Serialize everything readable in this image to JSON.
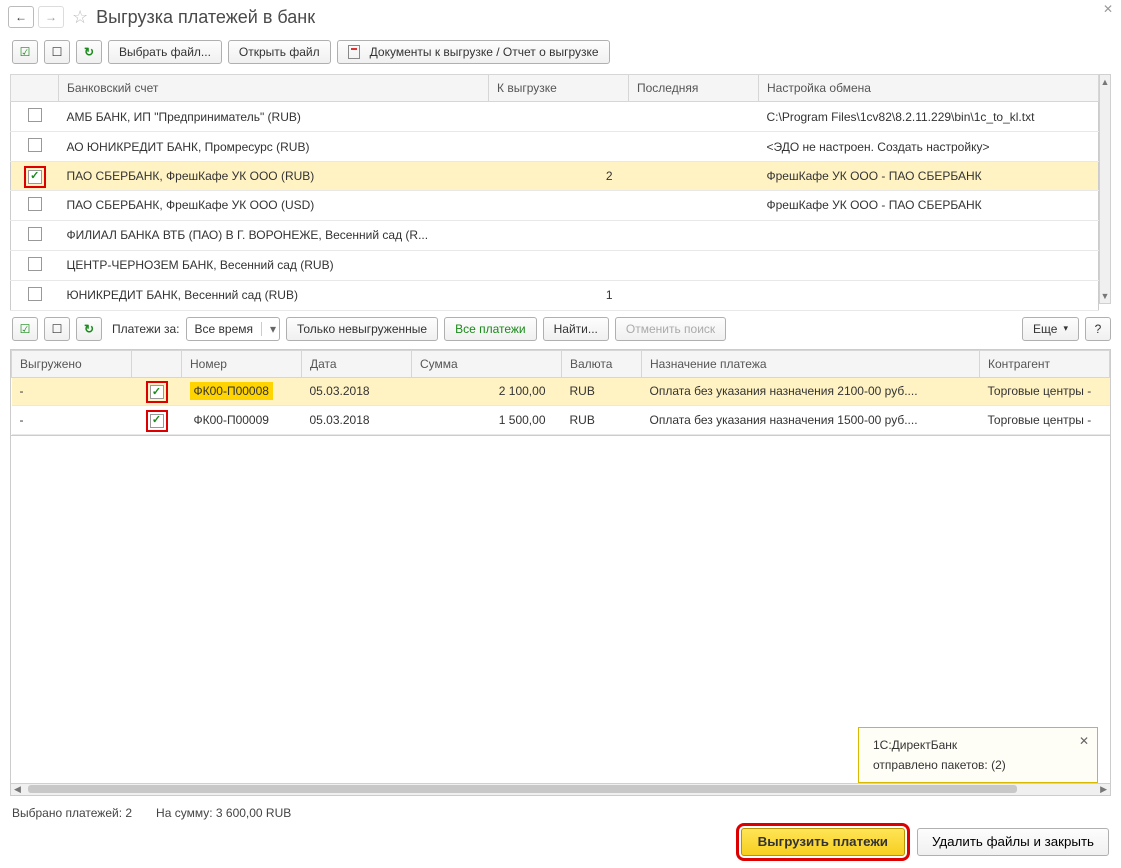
{
  "titlebar": {
    "title": "Выгрузка платежей в банк"
  },
  "toolbar1": {
    "choose_file": "Выбрать файл...",
    "open_file": "Открыть файл",
    "docs_report": "Документы к выгрузке / Отчет о выгрузке"
  },
  "accounts": {
    "headers": {
      "account": "Банковский счет",
      "to_export": "К выгрузке",
      "last": "Последняя",
      "settings": "Настройка обмена"
    },
    "rows": [
      {
        "checked": false,
        "name": "АМБ БАНК, ИП \"Предприниматель\" (RUB)",
        "to_export": "",
        "last": "",
        "settings": "C:\\Program Files\\1cv82\\8.2.11.229\\bin\\1c_to_kl.txt"
      },
      {
        "checked": false,
        "name": "АО ЮНИКРЕДИТ БАНК, Промресурс (RUB)",
        "to_export": "",
        "last": "",
        "settings": "<ЭДО не настроен. Создать настройку>"
      },
      {
        "checked": true,
        "name": "ПАО СБЕРБАНК, ФрешКафе УК ООО (RUB)",
        "to_export": "2",
        "last": "",
        "settings": "ФрешКафе УК ООО - ПАО СБЕРБАНК",
        "selected": true,
        "highlight": true
      },
      {
        "checked": false,
        "name": "ПАО СБЕРБАНК, ФрешКафе УК ООО (USD)",
        "to_export": "",
        "last": "",
        "settings": "ФрешКафе УК ООО - ПАО СБЕРБАНК"
      },
      {
        "checked": false,
        "name": "ФИЛИАЛ БАНКА ВТБ (ПАО) В Г. ВОРОНЕЖЕ, Весенний сад (R...",
        "to_export": "",
        "last": "",
        "settings": ""
      },
      {
        "checked": false,
        "name": "ЦЕНТР-ЧЕРНОЗЕМ БАНК, Весенний сад (RUB)",
        "to_export": "",
        "last": "",
        "settings": ""
      },
      {
        "checked": false,
        "name": "ЮНИКРЕДИТ БАНК, Весенний сад (RUB)",
        "to_export": "1",
        "last": "",
        "settings": ""
      }
    ]
  },
  "toolbar2": {
    "label_payments_for": "Платежи за:",
    "period_value": "Все время",
    "only_unexported": "Только невыгруженные",
    "all_payments": "Все платежи",
    "find": "Найти...",
    "cancel_search": "Отменить поиск",
    "more": "Еще",
    "help": "?"
  },
  "payments": {
    "headers": {
      "exported": "Выгружено",
      "chk": "",
      "number": "Номер",
      "date": "Дата",
      "sum": "Сумма",
      "currency": "Валюта",
      "purpose": "Назначение платежа",
      "counterparty": "Контрагент"
    },
    "rows": [
      {
        "exported": "-",
        "checked": true,
        "highlight": true,
        "number": "ФК00-П00008",
        "number_hl": true,
        "date": "05.03.2018",
        "sum": "2 100,00",
        "currency": "RUB",
        "purpose": "Оплата без указания назначения 2100-00 руб....",
        "counterparty": "Торговые центры -",
        "selected": true
      },
      {
        "exported": "-",
        "checked": true,
        "highlight": true,
        "number": "ФК00-П00009",
        "date": "05.03.2018",
        "sum": "1 500,00",
        "currency": "RUB",
        "purpose": "Оплата без указания назначения 1500-00 руб....",
        "counterparty": "Торговые центры -"
      }
    ]
  },
  "toast": {
    "title": "1С:ДиректБанк",
    "body": "отправлено пакетов: (2)"
  },
  "status": {
    "selected": "Выбрано платежей: 2",
    "sum": "На сумму: 3 600,00 RUB"
  },
  "footer": {
    "export": "Выгрузить платежи",
    "delete_close": "Удалить файлы и закрыть"
  }
}
